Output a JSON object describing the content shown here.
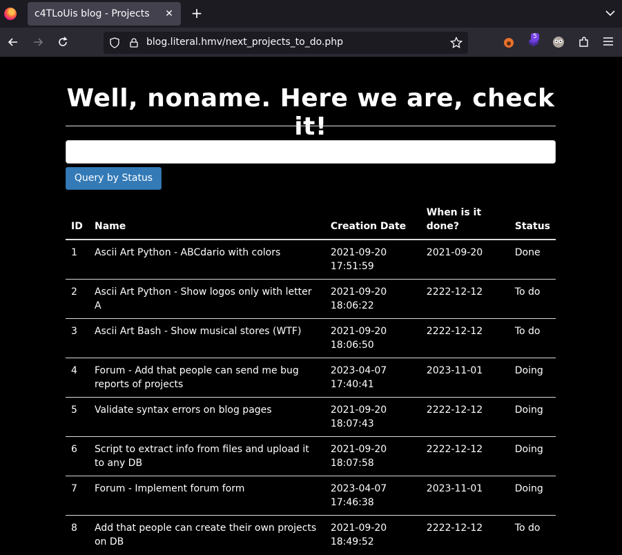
{
  "browser": {
    "tab_title": "c4TLoUis blog - Projects",
    "url": "blog.literal.hmv/next_projects_to_do.php",
    "extension_badge": "5"
  },
  "page": {
    "heading_prefix": "Well, ",
    "heading_user": "noname",
    "heading_suffix": ". Here we are, check it!",
    "search_value": "",
    "query_button": "Query by Status"
  },
  "table": {
    "headers": [
      "ID",
      "Name",
      "Creation Date",
      "When is it done?",
      "Status"
    ],
    "rows": [
      {
        "id": "1",
        "name": "Ascii Art Python - ABCdario with colors",
        "created": "2021-09-20 17:51:59",
        "done": "2021-09-20",
        "status": "Done"
      },
      {
        "id": "2",
        "name": "Ascii Art Python - Show logos only with letter A",
        "created": "2021-09-20 18:06:22",
        "done": "2222-12-12",
        "status": "To do"
      },
      {
        "id": "3",
        "name": "Ascii Art Bash - Show musical stores (WTF)",
        "created": "2021-09-20 18:06:50",
        "done": "2222-12-12",
        "status": "To do"
      },
      {
        "id": "4",
        "name": "Forum - Add that people can send me bug reports of projects",
        "created": "2023-04-07 17:40:41",
        "done": "2023-11-01",
        "status": "Doing"
      },
      {
        "id": "5",
        "name": "Validate syntax errors on blog pages",
        "created": "2021-09-20 18:07:43",
        "done": "2222-12-12",
        "status": "Doing"
      },
      {
        "id": "6",
        "name": "Script to extract info from files and upload it to any DB",
        "created": "2021-09-20 18:07:58",
        "done": "2222-12-12",
        "status": "Doing"
      },
      {
        "id": "7",
        "name": "Forum - Implement forum form",
        "created": "2023-04-07 17:46:38",
        "done": "2023-11-01",
        "status": "Doing"
      },
      {
        "id": "8",
        "name": "Add that people can create their own projects on DB",
        "created": "2021-09-20 18:49:52",
        "done": "2222-12-12",
        "status": "To do"
      }
    ]
  }
}
